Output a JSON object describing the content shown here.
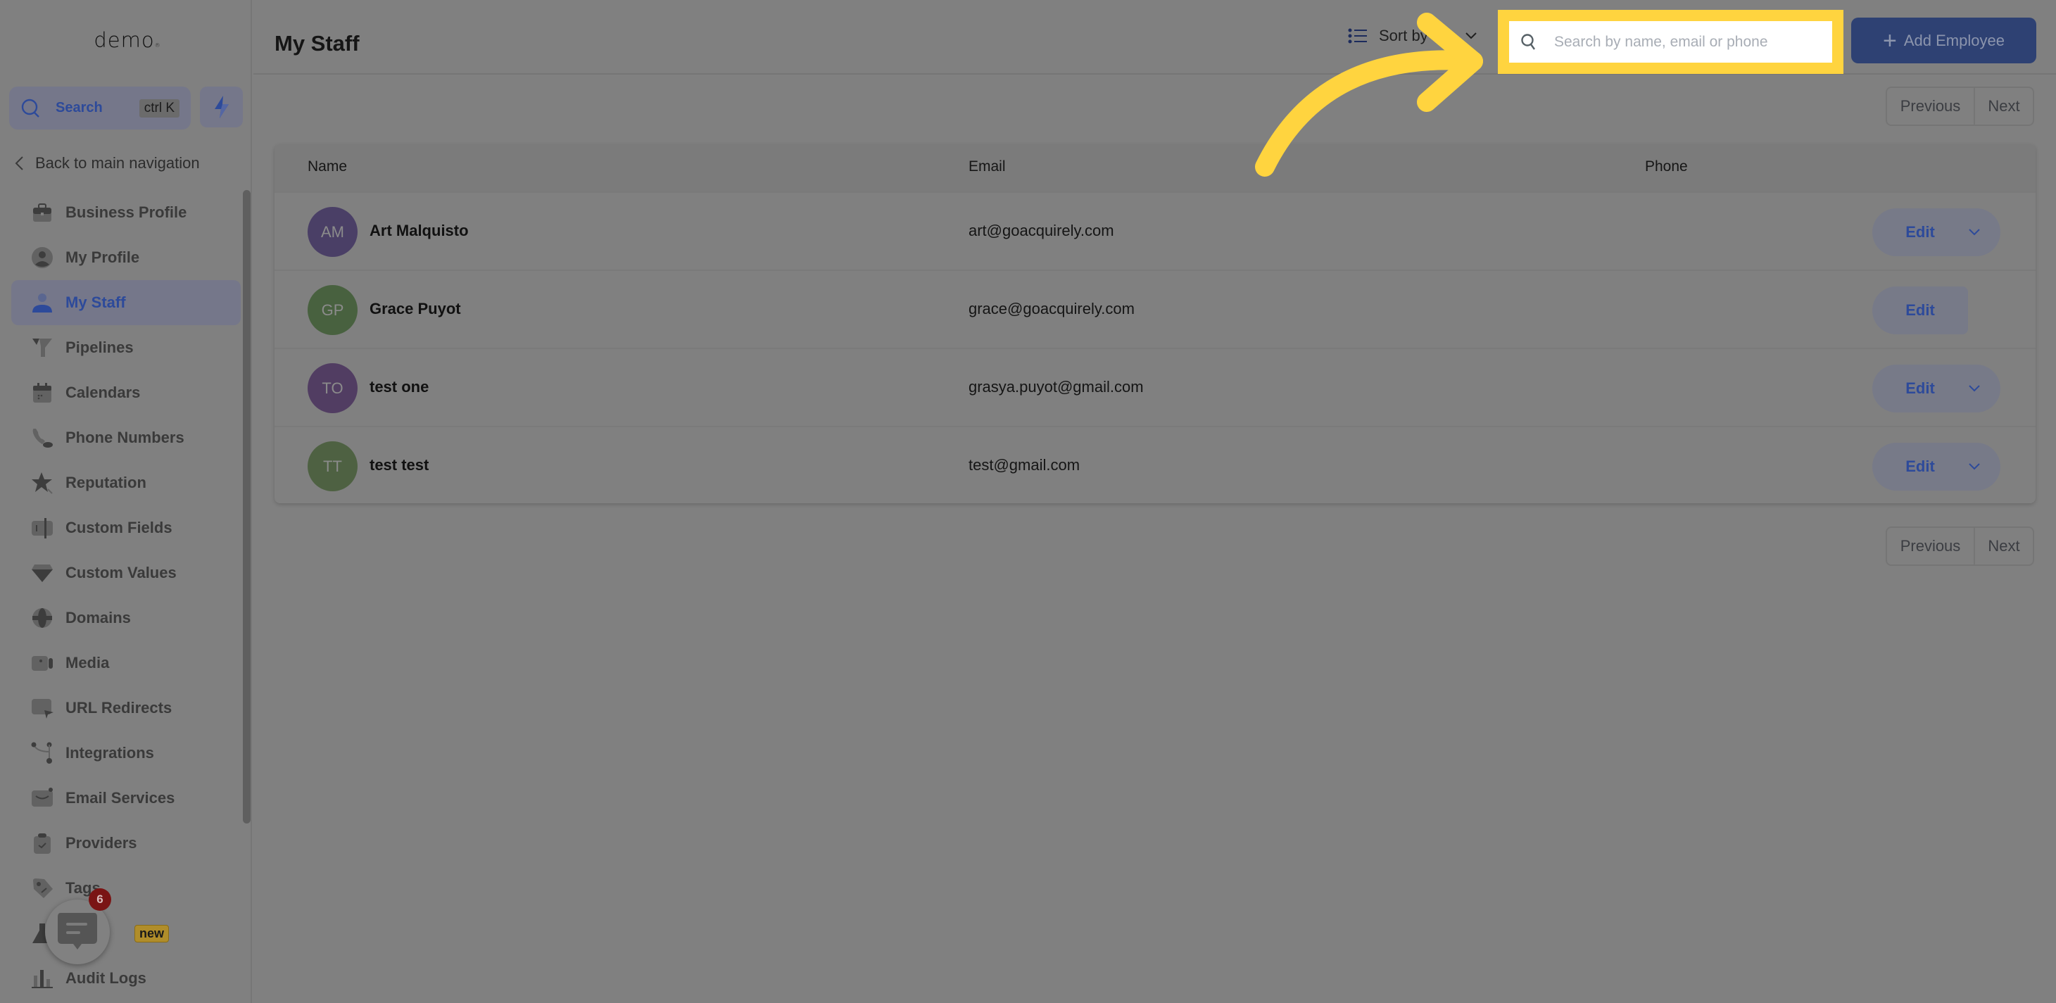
{
  "app": {
    "logo_text": "demo",
    "title": "My Staff"
  },
  "sidebar": {
    "search_label": "Search",
    "search_shortcut": "ctrl K",
    "back_label": "Back to main navigation",
    "items": [
      {
        "label": "Business Profile",
        "icon": "briefcase-icon",
        "active": false
      },
      {
        "label": "My Profile",
        "icon": "user-circle-icon",
        "active": false
      },
      {
        "label": "My Staff",
        "icon": "user-icon",
        "active": true
      },
      {
        "label": "Pipelines",
        "icon": "funnel-icon",
        "active": false
      },
      {
        "label": "Calendars",
        "icon": "calendar-icon",
        "active": false
      },
      {
        "label": "Phone Numbers",
        "icon": "phone-icon",
        "active": false
      },
      {
        "label": "Reputation",
        "icon": "star-icon",
        "active": false
      },
      {
        "label": "Custom Fields",
        "icon": "text-field-icon",
        "active": false
      },
      {
        "label": "Custom Values",
        "icon": "diamond-icon",
        "active": false
      },
      {
        "label": "Domains",
        "icon": "globe-icon",
        "active": false
      },
      {
        "label": "Media",
        "icon": "video-icon",
        "active": false
      },
      {
        "label": "URL Redirects",
        "icon": "redirect-icon",
        "active": false
      },
      {
        "label": "Integrations",
        "icon": "integrations-icon",
        "active": false
      },
      {
        "label": "Email Services",
        "icon": "mail-icon",
        "active": false
      },
      {
        "label": "Providers",
        "icon": "clipboard-check-icon",
        "active": false
      },
      {
        "label": "Tags",
        "icon": "tag-icon",
        "active": false
      },
      {
        "label": "",
        "icon": "flask-icon",
        "active": false,
        "badge": "new"
      },
      {
        "label": "Audit Logs",
        "icon": "bar-chart-icon",
        "active": false
      }
    ]
  },
  "chat_widget": {
    "unread_count": "6"
  },
  "toolbar": {
    "sort_label": "Sort by",
    "search_placeholder": "Search by name, email or phone",
    "search_value": "",
    "add_label": "Add Employee"
  },
  "pagination": {
    "previous_label": "Previous",
    "next_label": "Next"
  },
  "table": {
    "columns": [
      "Name",
      "Email",
      "Phone"
    ],
    "rows": [
      {
        "initials": "AM",
        "name": "Art Malquisto",
        "email": "art@goacquirely.com",
        "phone": "",
        "avatar_color": "#4a3f66",
        "edit_label": "Edit",
        "has_dropdown": true
      },
      {
        "initials": "GP",
        "name": "Grace Puyot",
        "email": "grace@goacquirely.com",
        "phone": "",
        "avatar_color": "#48613f",
        "edit_label": "Edit",
        "has_dropdown": false
      },
      {
        "initials": "TO",
        "name": "test one",
        "email": "grasya.puyot@gmail.com",
        "phone": "",
        "avatar_color": "#513d62",
        "edit_label": "Edit",
        "has_dropdown": true
      },
      {
        "initials": "TT",
        "name": "test test",
        "email": "test@gmail.com",
        "phone": "",
        "avatar_color": "#4e6142",
        "edit_label": "Edit",
        "has_dropdown": true
      }
    ]
  },
  "colors": {
    "overlay_bg": "#808080",
    "accent": "#2d4a9a",
    "highlight": "#ffd43f",
    "add_button": "#2e4173"
  }
}
